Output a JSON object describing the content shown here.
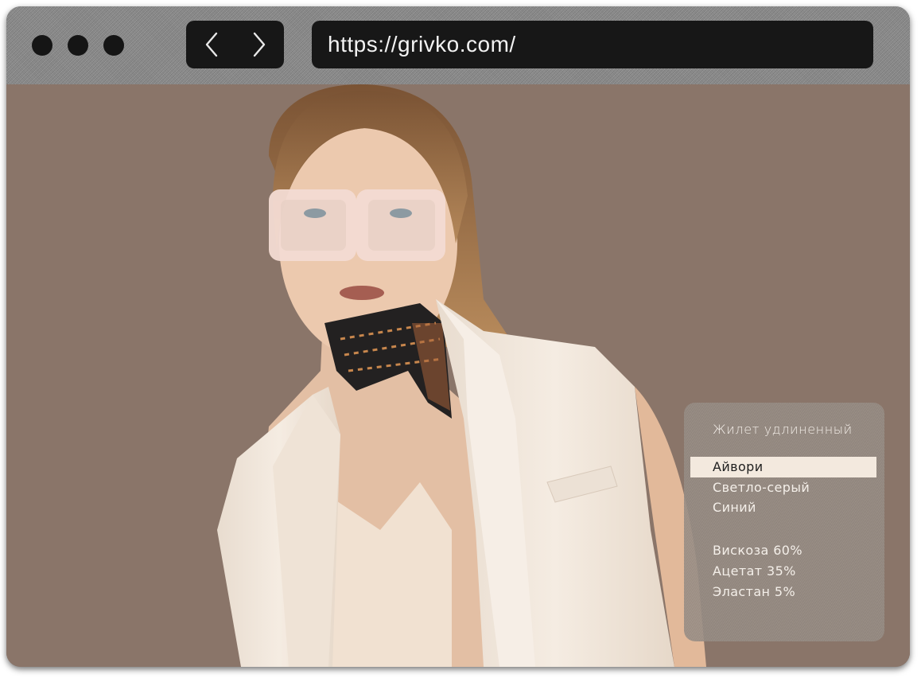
{
  "browser": {
    "url": "https://grivko.com/",
    "back_icon": "chevron-left-icon",
    "forward_icon": "chevron-right-icon"
  },
  "product_panel": {
    "title": "Жилет удлиненный",
    "colors": [
      {
        "label": "Айвори",
        "selected": true
      },
      {
        "label": "Светло-серый",
        "selected": false
      },
      {
        "label": "Синий",
        "selected": false
      }
    ],
    "composition": [
      "Вискоза 60%",
      "Ацетат 35%",
      "Эластан 5%"
    ]
  },
  "colors": {
    "background": "#8a7569",
    "selected_option": "#f3e9de",
    "vest": "#f1e6da",
    "titlebar": "#8c8c8c"
  }
}
